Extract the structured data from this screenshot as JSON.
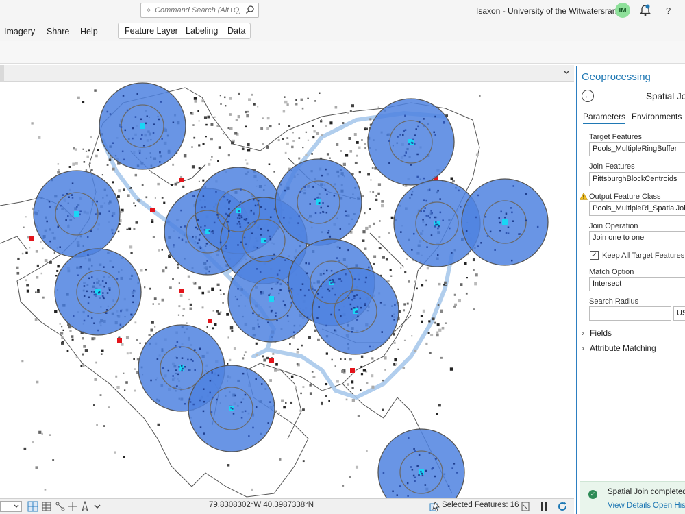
{
  "search": {
    "placeholder": "Command Search (Alt+Q)"
  },
  "header": {
    "user": "Isaxon - University of the Witwatersrand",
    "avatar_initials": "IM",
    "help": "?"
  },
  "menu": {
    "items": [
      "Imagery",
      "Share",
      "Help"
    ]
  },
  "contextual_tabs": [
    "Feature Layer",
    "Labeling",
    "Data"
  ],
  "status": {
    "coordinates": "79.8308302°W 40.3987338°N",
    "selected": "Selected Features: 16"
  },
  "geoprocessing": {
    "title": "Geoprocessing",
    "tool": "Spatial Join",
    "tabs": [
      "Parameters",
      "Environments"
    ],
    "target_label": "Target Features",
    "target_value": "Pools_MultipleRingBuffer",
    "join_label": "Join Features",
    "join_value": "PittsburghBlockCentroids",
    "output_label": "Output Feature Class",
    "output_value": "Pools_MultipleRi_SpatialJoin",
    "operation_label": "Join Operation",
    "operation_value": "Join one to one",
    "keep_label": "Keep All Target Features",
    "match_label": "Match Option",
    "match_value": "Intersect",
    "radius_label": "Search Radius",
    "radius_unit": "US",
    "fields_label": "Fields",
    "attr_label": "Attribute Matching",
    "toast_msg": "Spatial Join completed.",
    "toast_link1": "View Details",
    "toast_link2": "Open History"
  },
  "colors": {
    "buffer_fill": "#4f83e0",
    "pool_point": "#19d6f5",
    "accent": "#1f78b4",
    "river": "#a9c9ec"
  }
}
